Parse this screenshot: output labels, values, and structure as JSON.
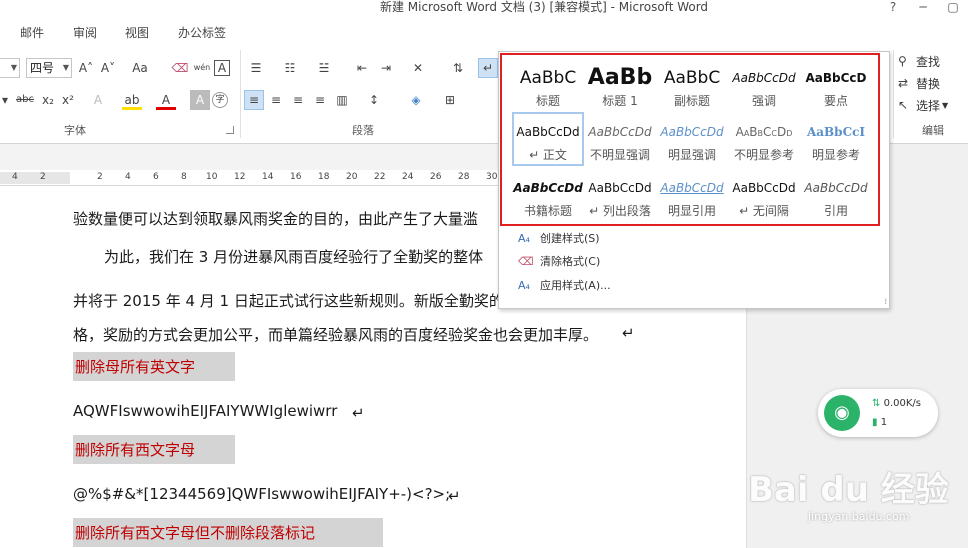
{
  "window": {
    "title": "新建 Microsoft Word 文档 (3) [兼容模式] - Microsoft Word",
    "help": "?",
    "minimize": "─",
    "restore": "▢"
  },
  "tabs": [
    "邮件",
    "审阅",
    "视图",
    "办公标签"
  ],
  "ribbon": {
    "font_size": "四号",
    "font_group_label": "字体",
    "paragraph_group_label": "段落",
    "editing_group_label": "编辑",
    "font_buttons": [
      "A˄",
      "A˅",
      "Aa",
      "⌫",
      "wén",
      "A"
    ],
    "format_buttons": [
      "abc",
      "x₂",
      "x²",
      "A",
      "ab",
      "A",
      "A",
      "字"
    ],
    "editing": {
      "find": "查找",
      "replace": "替换",
      "select": "选择"
    }
  },
  "ruler": {
    "ticks": [
      "4",
      "2",
      "2",
      "4",
      "6",
      "8",
      "10",
      "12",
      "14",
      "16",
      "18",
      "20",
      "22",
      "24",
      "26",
      "28",
      "30"
    ]
  },
  "styles_panel": {
    "styles": [
      {
        "sample": "AaBbC",
        "name": "标题"
      },
      {
        "sample": "AaBb",
        "name": "标题 1"
      },
      {
        "sample": "AaBbC",
        "name": "副标题"
      },
      {
        "sample": "AaBbCcDd",
        "name": "强调"
      },
      {
        "sample": "AaBbCcD",
        "name": "要点"
      },
      {
        "sample": "AaBbCcDd",
        "name": "↵ 正文"
      },
      {
        "sample": "AaBbCcDd",
        "name": "不明显强调"
      },
      {
        "sample": "AaBbCcDd",
        "name": "明显强调"
      },
      {
        "sample": "AaBbCcDd",
        "name": "不明显参考"
      },
      {
        "sample": "AaBbCcI",
        "name": "明显参考"
      },
      {
        "sample": "AaBbCcDd",
        "name": "书籍标题"
      },
      {
        "sample": "AaBbCcDd",
        "name": "↵ 列出段落"
      },
      {
        "sample": "AaBbCcDd",
        "name": "明显引用"
      },
      {
        "sample": "AaBbCcDd",
        "name": "↵ 无间隔"
      },
      {
        "sample": "AaBbCcDd",
        "name": "引用"
      }
    ],
    "actions": {
      "create": "创建样式(S)",
      "clear": "清除格式(C)",
      "apply": "应用样式(A)..."
    }
  },
  "document": {
    "line1": "验数量便可以达到领取暴风雨奖金的目的，由此产生了大量滥",
    "line2": "为此，我们在 3 月份进暴风雨百度经验行了全勤奖的整体",
    "line3": "并将于 2015 年 4 月 1 日起正式试行这些新规则。新版全勤奖的",
    "line4": "格，奖励的方式会更加公平，而单篇经验暴风雨的百度经验奖金也会更加丰厚。",
    "heading1": "删除母所有英文字",
    "text1": "AQWFIswwowihEIJFAIYWWIglewiwrr",
    "heading2": "删除所有西文字母",
    "text2": "@%$#&*[12344569]QWFIswwowihEIJFAIY+-)<?>;",
    "heading3": "删除所有西文字母但不删除段落标记",
    "para_mark": "↵"
  },
  "net_widget": {
    "speed": "0.00K/s",
    "count": "1"
  },
  "watermark": {
    "brand": "Bai du 经验",
    "url": "jingyan.baidu.com"
  },
  "colors": {
    "highlight_red": "#c00000",
    "panel_border": "#e02020",
    "wifi_green": "#2bb36a"
  }
}
